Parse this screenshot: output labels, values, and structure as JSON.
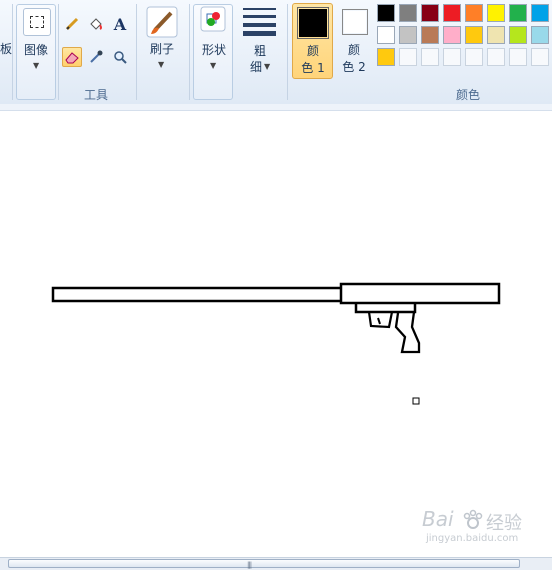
{
  "ribbon": {
    "clipboard_partial": "板",
    "image": {
      "label": "图像"
    },
    "tools": {
      "group_label": "工具",
      "text_tool": "A"
    },
    "brushes": {
      "label": "刷子"
    },
    "shapes": {
      "label": "形状"
    },
    "size": {
      "line1": "粗",
      "line2": "细"
    },
    "color1": {
      "line1": "颜",
      "line2": "色 1",
      "value": "#000000"
    },
    "color2": {
      "line1": "颜",
      "line2": "色 2",
      "value": "#ffffff"
    },
    "colors": {
      "group_label": "颜色",
      "row1": [
        "#000000",
        "#7f7f7f",
        "#880015",
        "#ed1c24",
        "#ff7f27",
        "#fff200",
        "#22b14c",
        "#00a2e8"
      ],
      "row2": [
        "#ffffff",
        "#c3c3c3",
        "#b97a57",
        "#ffaec9",
        "#ffc90e",
        "#efe4b0",
        "#b5e61d",
        "#99d9ea"
      ],
      "row3": [
        "#ffc90e"
      ]
    }
  },
  "watermark": {
    "brand": "Bai",
    "brand2": "经验",
    "url": "jingyan.baidu.com"
  },
  "scrollbar": {
    "grip": "|||"
  }
}
